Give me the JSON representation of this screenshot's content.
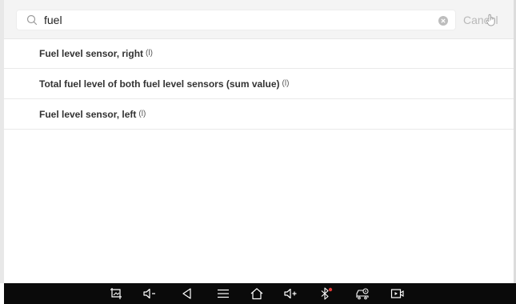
{
  "search": {
    "value": "fuel",
    "placeholder": "",
    "cancel_label": "Cancel",
    "search_icon": "search-icon",
    "clear_icon": "clear-circle-icon"
  },
  "results": [
    {
      "name": "Fuel level sensor, right",
      "unit": "(l)"
    },
    {
      "name": "Total fuel level of both fuel level sensors (sum value)",
      "unit": "(l)"
    },
    {
      "name": "Fuel level sensor, left",
      "unit": "(l)"
    }
  ],
  "navbar": {
    "icons": [
      "screenshot-icon",
      "volume-down-icon",
      "back-icon",
      "menu-icon",
      "home-icon",
      "volume-up-icon",
      "bluetooth-icon",
      "vehicle-connection-icon",
      "screen-record-icon"
    ],
    "background": "#0a0a0a"
  },
  "colors": {
    "search_bar_bg": "#f4f4f4",
    "cancel_text": "#b9b9b9",
    "row_divider": "#e9e9e9",
    "bluetooth_dot": "#e53935"
  }
}
